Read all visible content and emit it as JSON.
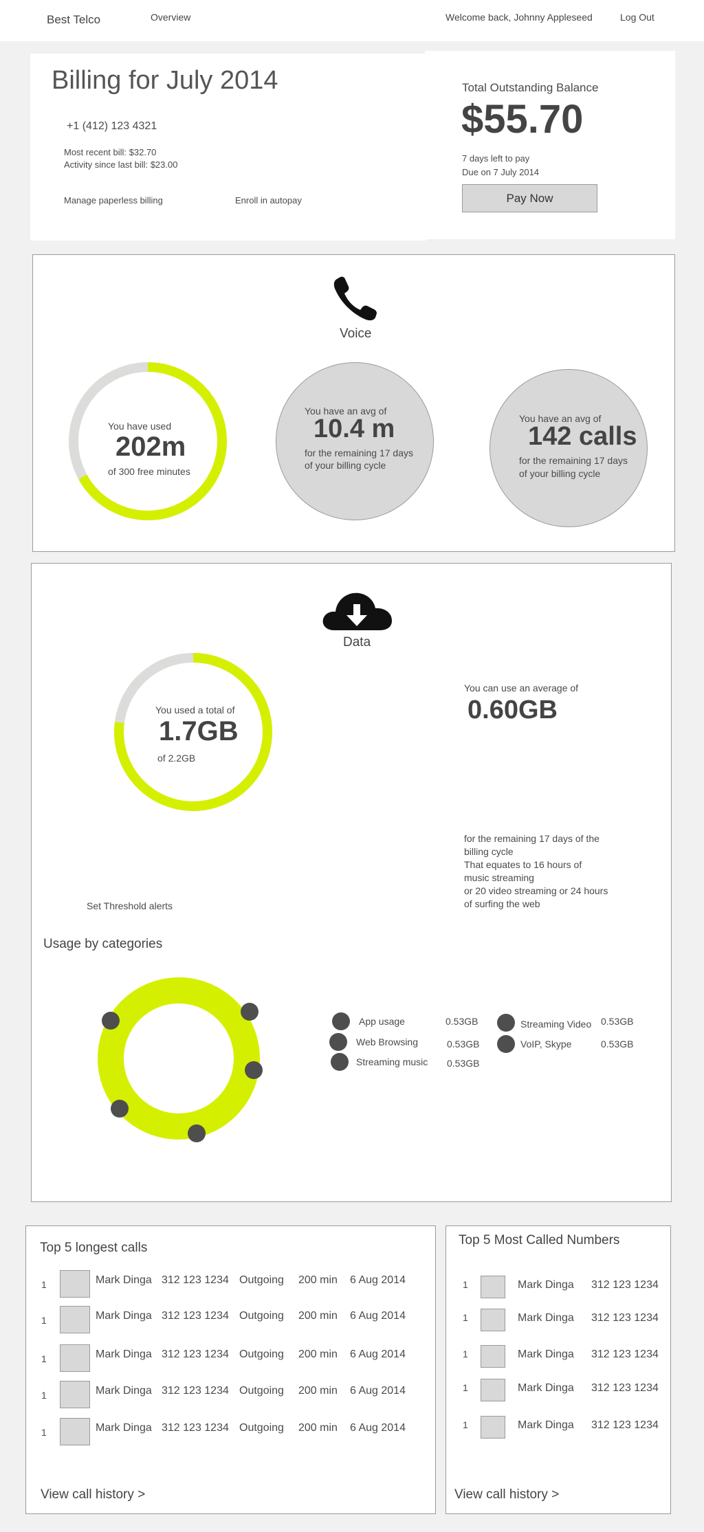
{
  "nav": {
    "brand": "Best Telco",
    "overview": "Overview",
    "welcome": "Welcome back, Johnny Appleseed",
    "logout": "Log Out"
  },
  "billing": {
    "title": "Billing for July 2014",
    "phone": "+1 (412) 123 4321",
    "recent_bill": "Most recent bill: $32.70",
    "activity": "Activity since last bill: $23.00",
    "paperless": "Manage paperless billing",
    "autopay": "Enroll in autopay",
    "balance_label": "Total Outstanding Balance",
    "balance": "$55.70",
    "days_left": "7 days left to pay",
    "due": "Due on 7 July 2014",
    "pay_now": "Pay Now"
  },
  "voice": {
    "title": "Voice",
    "used_label": "You have used",
    "used_value": "202m",
    "used_sub": "of 300 free minutes",
    "used_fraction": 0.67,
    "avg1_label": "You have an avg of",
    "avg1_value": "10.4 m",
    "avg1_sub1": "for the remaining 17 days",
    "avg1_sub2": "of your billing cycle",
    "avg2_label": "You have an avg of",
    "avg2_value": "142 calls",
    "avg2_sub1": "for the remaining 17 days",
    "avg2_sub2": "of your billing cycle"
  },
  "data_usage": {
    "title": "Data",
    "used_label": "You used a total of",
    "used_value": "1.7GB",
    "used_sub": "of 2.2GB",
    "used_fraction": 0.77,
    "avg_label": "You can use an average of",
    "avg_value": "0.60GB",
    "desc1": "for the remaining 17 days of the",
    "desc2": "billing cycle",
    "desc3": "That equates to 16 hours of",
    "desc4": "music streaming",
    "desc5": "or 20 video streaming or 24 hours",
    "desc6": "of surfing the web",
    "threshold": "Set Threshold alerts",
    "categories_title": "Usage by categories",
    "categories": [
      {
        "name": "App usage",
        "value": "0.53GB"
      },
      {
        "name": "Web Browsing",
        "value": "0.53GB"
      },
      {
        "name": "Streaming music",
        "value": "0.53GB"
      },
      {
        "name": "Streaming Video",
        "value": "0.53GB"
      },
      {
        "name": "VoIP, Skype",
        "value": "0.53GB"
      }
    ]
  },
  "longest_calls": {
    "title": "Top 5 longest calls",
    "rows": [
      {
        "rank": "1",
        "name": "Mark Dinga",
        "number": "312 123 1234",
        "direction": "Outgoing",
        "duration": "200 min",
        "date": "6 Aug 2014"
      },
      {
        "rank": "1",
        "name": "Mark Dinga",
        "number": "312 123 1234",
        "direction": "Outgoing",
        "duration": "200 min",
        "date": "6 Aug 2014"
      },
      {
        "rank": "1",
        "name": "Mark Dinga",
        "number": "312 123 1234",
        "direction": "Outgoing",
        "duration": "200 min",
        "date": "6 Aug 2014"
      },
      {
        "rank": "1",
        "name": "Mark Dinga",
        "number": "312 123 1234",
        "direction": "Outgoing",
        "duration": "200 min",
        "date": "6 Aug 2014"
      },
      {
        "rank": "1",
        "name": "Mark Dinga",
        "number": "312 123 1234",
        "direction": "Outgoing",
        "duration": "200 min",
        "date": "6 Aug 2014"
      }
    ],
    "history_link": "View call history >"
  },
  "most_called": {
    "title": "Top 5 Most Called Numbers",
    "rows": [
      {
        "rank": "1",
        "name": "Mark Dinga",
        "number": "312 123 1234"
      },
      {
        "rank": "1",
        "name": "Mark Dinga",
        "number": "312 123 1234"
      },
      {
        "rank": "1",
        "name": "Mark Dinga",
        "number": "312 123 1234"
      },
      {
        "rank": "1",
        "name": "Mark Dinga",
        "number": "312 123 1234"
      },
      {
        "rank": "1",
        "name": "Mark Dinga",
        "number": "312 123 1234"
      }
    ],
    "history_link": "View call history >"
  },
  "colors": {
    "accent": "#d4f000",
    "track": "#dcdcda",
    "dot": "#4e4e4e"
  },
  "icons": [
    "phone-icon",
    "cloud-download-icon"
  ]
}
